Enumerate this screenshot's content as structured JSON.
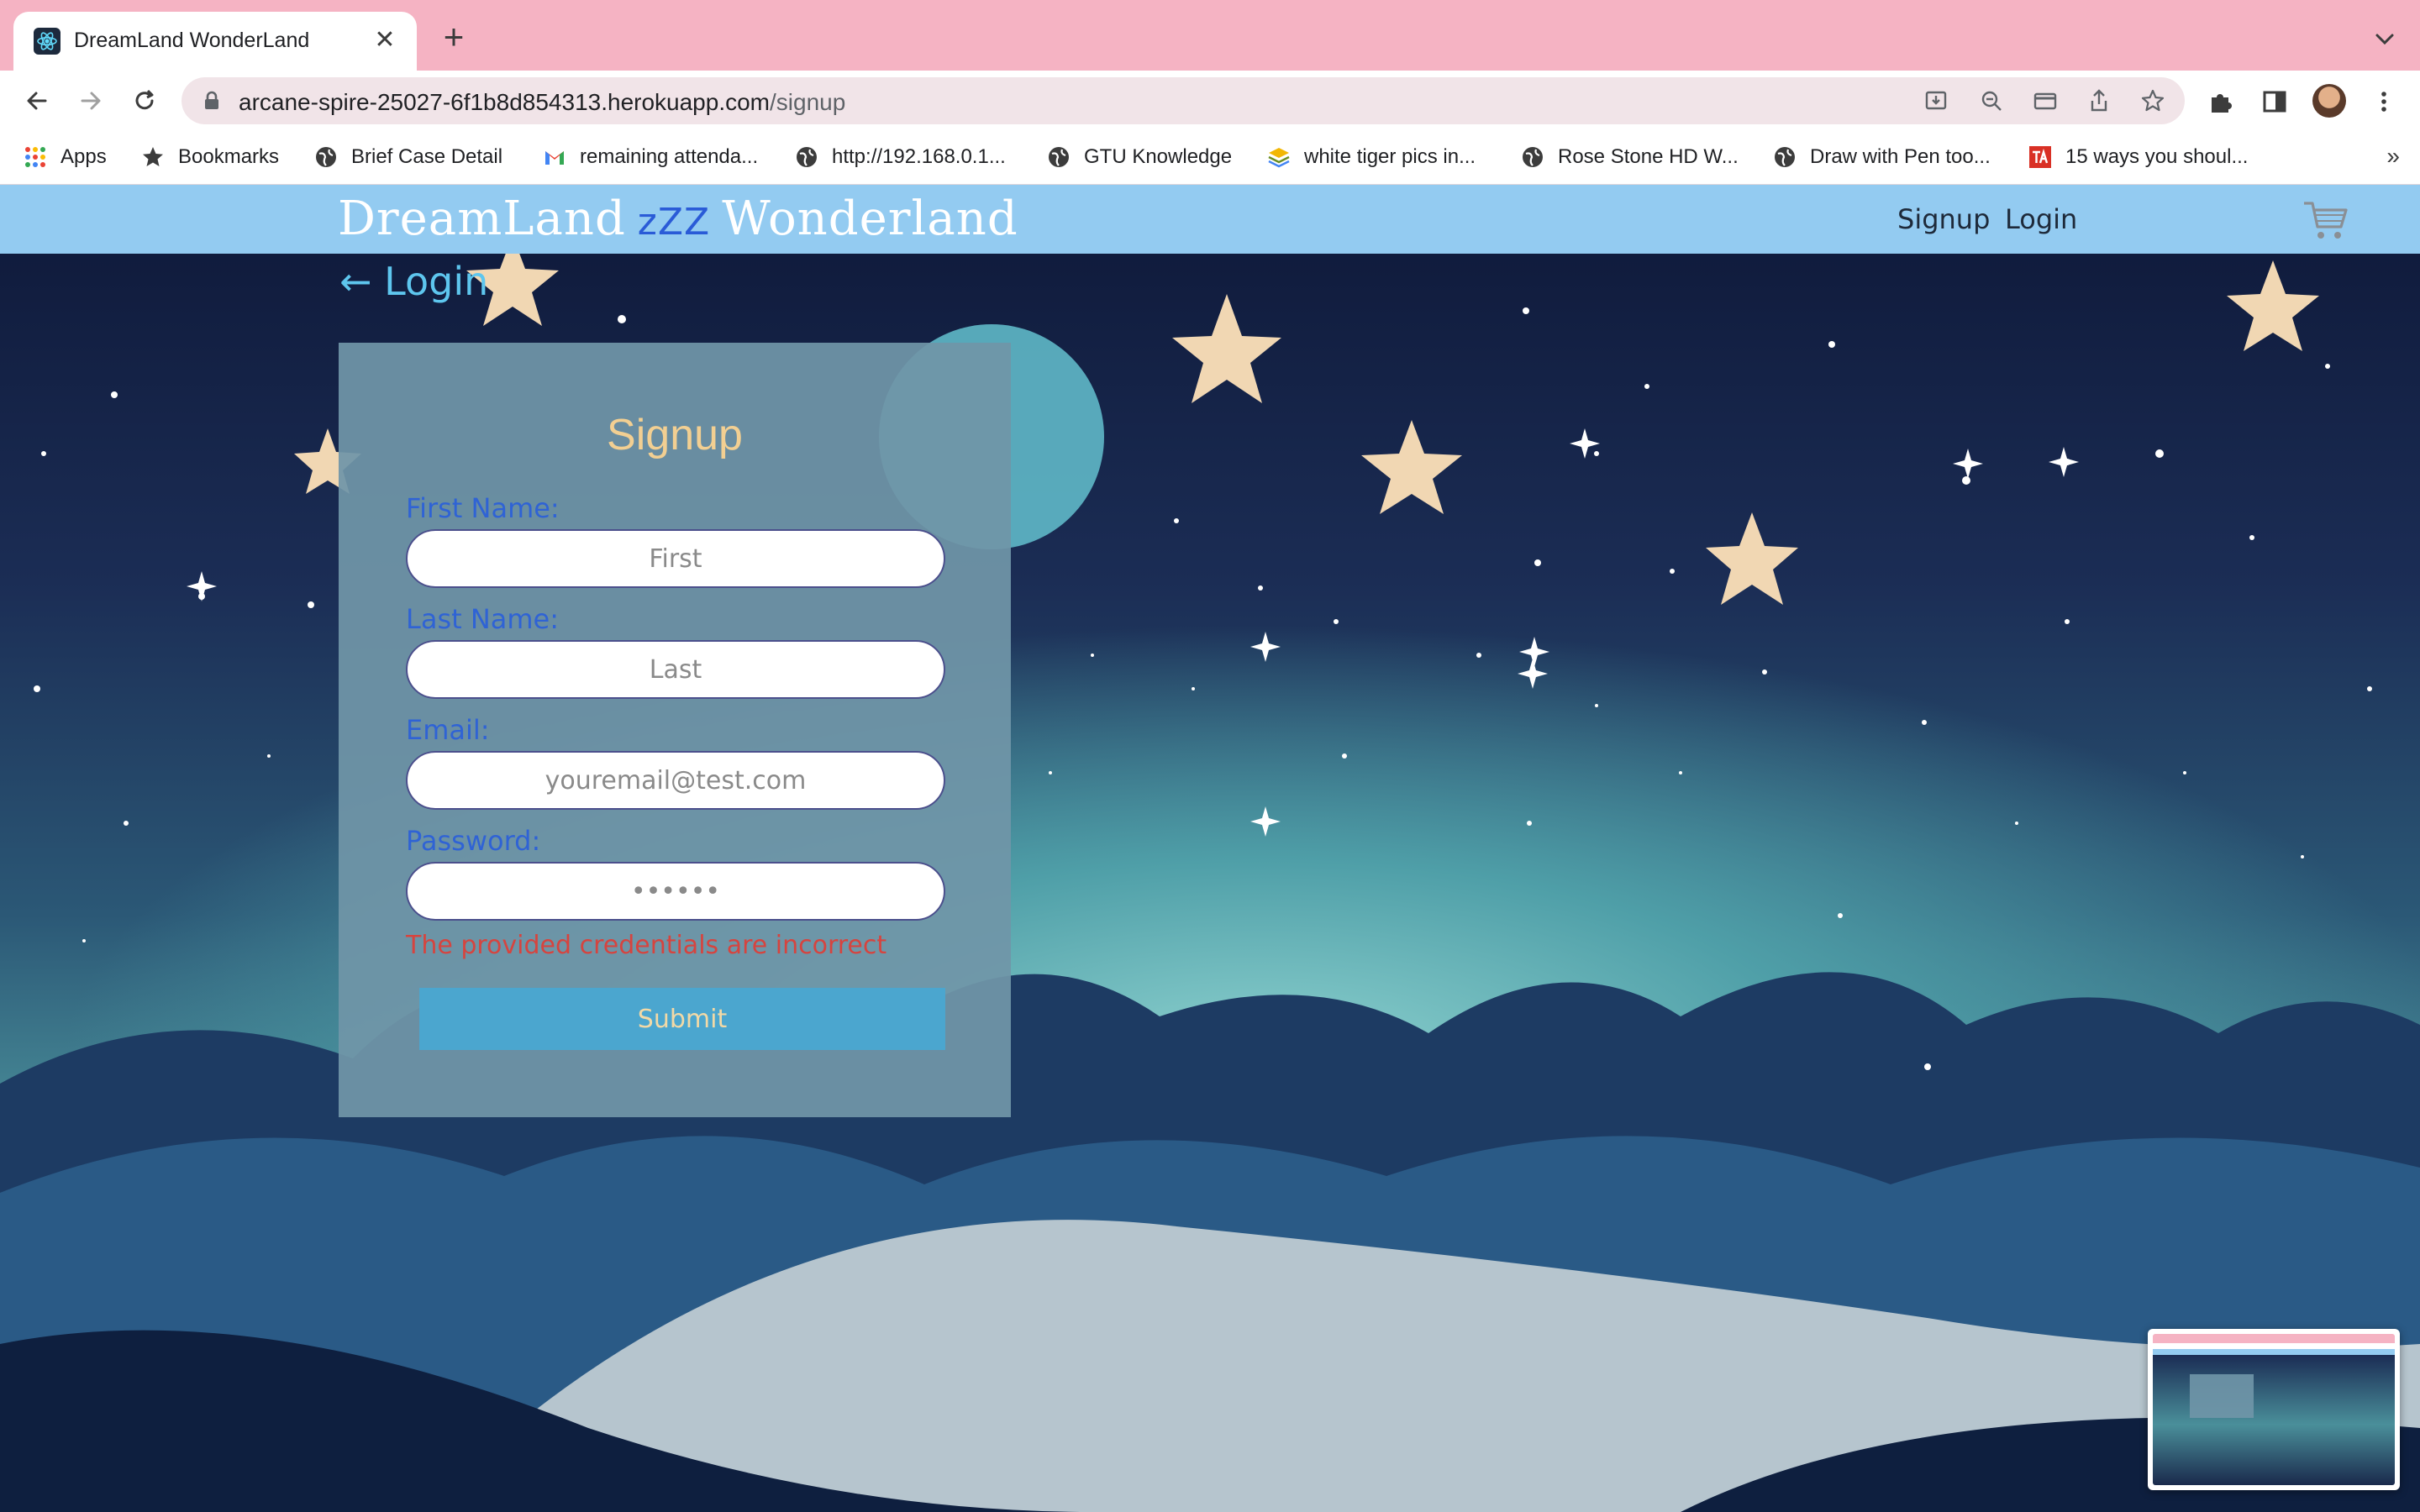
{
  "browser": {
    "tab_title": "DreamLand WonderLand",
    "tab_close": "✕",
    "new_tab": "+",
    "url_host": "arcane-spire-25027-6f1b8d854313.herokuapp.com",
    "url_path": "/signup",
    "bookmarks": [
      {
        "label": "Apps",
        "icon": "apps-grid-icon"
      },
      {
        "label": "Bookmarks",
        "icon": "star-icon"
      },
      {
        "label": "Brief Case Detail",
        "icon": "globe-icon"
      },
      {
        "label": "remaining attenda...",
        "icon": "gmail-icon"
      },
      {
        "label": "http://192.168.0.1...",
        "icon": "globe-icon"
      },
      {
        "label": "GTU Knowledge",
        "icon": "globe-icon"
      },
      {
        "label": "white tiger pics in...",
        "icon": "layers-icon"
      },
      {
        "label": "Rose Stone HD W...",
        "icon": "globe-icon"
      },
      {
        "label": "Draw with Pen too...",
        "icon": "globe-icon"
      },
      {
        "label": "15 ways you shoul...",
        "icon": "ta-icon"
      }
    ],
    "bookmarks_more": "»"
  },
  "site": {
    "brand_left": "DreamLand",
    "brand_zzz": "zZZ",
    "brand_right": "Wonderland",
    "nav": {
      "signup": "Signup",
      "login": "Login"
    },
    "back_link": "← Login"
  },
  "form": {
    "title": "Signup",
    "first_name_label": "First Name:",
    "first_name_placeholder": "First",
    "last_name_label": "Last Name:",
    "last_name_placeholder": "Last",
    "email_label": "Email:",
    "email_placeholder": "youremail@test.com",
    "password_label": "Password:",
    "password_placeholder": "••••••",
    "error": "The provided credentials are incorrect",
    "submit": "Submit"
  },
  "colors": {
    "tabstrip": "#f5b3c3",
    "site_header": "#93cbf1",
    "form_title": "#f2cf92",
    "label": "#2f63d5",
    "error": "#d6443f",
    "submit_bg": "#4ba6cf"
  }
}
